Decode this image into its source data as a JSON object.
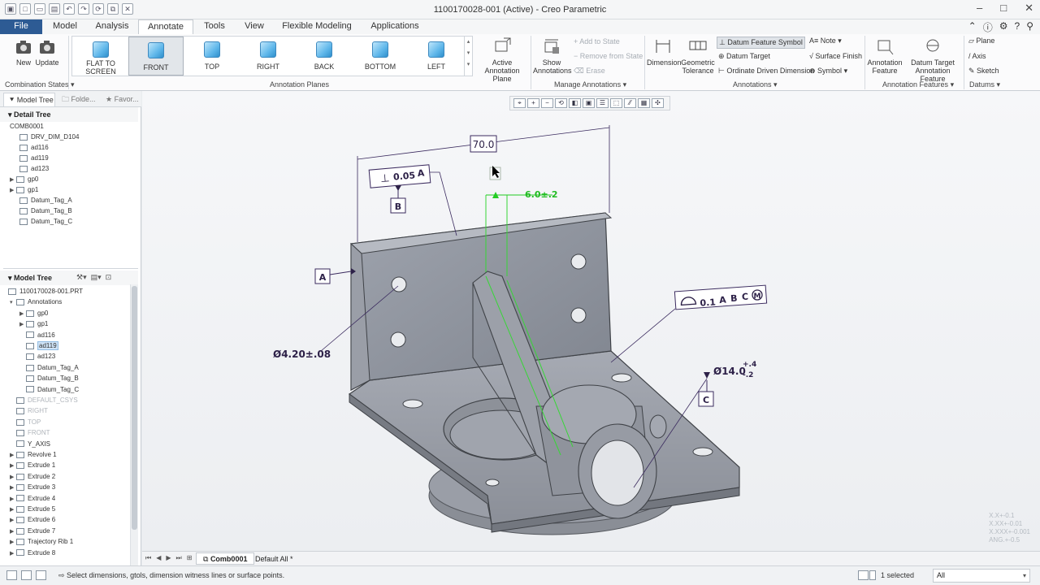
{
  "window": {
    "title": "1100170028-001 (Active) - Creo Parametric"
  },
  "menu": {
    "tabs": [
      "File",
      "Model",
      "Analysis",
      "Annotate",
      "Tools",
      "View",
      "Flexible Modeling",
      "Applications"
    ],
    "active": "Annotate"
  },
  "ribbon": {
    "combination": {
      "new": "New",
      "update": "Update",
      "label": "Combination States"
    },
    "flat_to_screen": "FLAT TO\nSCREEN",
    "planes": [
      "FRONT",
      "TOP",
      "RIGHT",
      "BACK",
      "BOTTOM",
      "LEFT"
    ],
    "active_plane_label": "Active\nAnnotation Plane",
    "annotation_planes_label": "Annotation Planes",
    "show_annotations": "Show\nAnnotations",
    "add_to_state": "Add to State",
    "remove_from_state": "Remove from State",
    "erase": "Erase",
    "manage_annotations_label": "Manage Annotations",
    "dimension": "Dimension",
    "geometric_tolerance": "Geometric\nTolerance",
    "datum_feature_symbol": "Datum Feature Symbol",
    "datum_target": "Datum Target",
    "ordinate_driven_dimension": "Ordinate Driven Dimension",
    "note": "Note",
    "surface_finish": "Surface Finish",
    "symbol": "Symbol",
    "annotations_label": "Annotations",
    "annotation_feature": "Annotation\nFeature",
    "datum_target_annotation_feature": "Datum Target\nAnnotation Feature",
    "annotation_features_label": "Annotation Features",
    "plane": "Plane",
    "axis": "Axis",
    "sketch": "Sketch",
    "datums_label": "Datums"
  },
  "left_panel": {
    "tabs": [
      "Model Tree",
      "Folde...",
      "Favor..."
    ],
    "detail_tree": {
      "header": "Detail Tree",
      "items": [
        "COMB0001",
        "DRV_DIM_D104",
        "ad116",
        "ad119",
        "ad123",
        "gp0",
        "gp1",
        "Datum_Tag_A",
        "Datum_Tag_B",
        "Datum_Tag_C"
      ]
    },
    "model_tree": {
      "header": "Model Tree",
      "items": [
        "1100170028-001.PRT",
        "Annotations",
        "gp0",
        "gp1",
        "ad116",
        "ad119",
        "ad123",
        "Datum_Tag_A",
        "Datum_Tag_B",
        "Datum_Tag_C",
        "DEFAULT_CSYS",
        "RIGHT",
        "TOP",
        "FRONT",
        "Y_AXIS",
        "Revolve 1",
        "Extrude 1",
        "Extrude 2",
        "Extrude 3",
        "Extrude 4",
        "Extrude 5",
        "Extrude 6",
        "Extrude 7",
        "Trajectory Rib 1",
        "Extrude 8"
      ],
      "selected": "ad119"
    }
  },
  "graphics": {
    "dims": {
      "width_dim": "70.0",
      "perp_value": "0.05",
      "perp_datum": "A",
      "datum_b": "B",
      "datum_a": "A",
      "datum_c": "C",
      "green_dim": "6.0±.2",
      "hole_dim": "Ø4.20±.08",
      "profile_value": "0.1",
      "profile_datums": [
        "A",
        "B",
        "C"
      ],
      "modifier": "M",
      "bore_dim": "Ø14.0",
      "bore_tol_upper": "+.4",
      "bore_tol_lower": "-.2"
    },
    "tolerance_table": [
      "X.X+-0.1",
      "X.XX+-0.01",
      "X.XXX+-0.001",
      "ANG.+-0.5"
    ]
  },
  "bottom": {
    "sheet_tab": "Comb0001",
    "state_tab": "Default All *"
  },
  "status": {
    "message": "Select dimensions, gtols, dimension witness lines or surface points.",
    "selected": "1 selected",
    "filter": "All"
  },
  "colors": {
    "file_tab": "#2d5b94",
    "annotation": "#3a2a5e",
    "highlight_green": "#22cc22",
    "part": "#8a8f99"
  }
}
